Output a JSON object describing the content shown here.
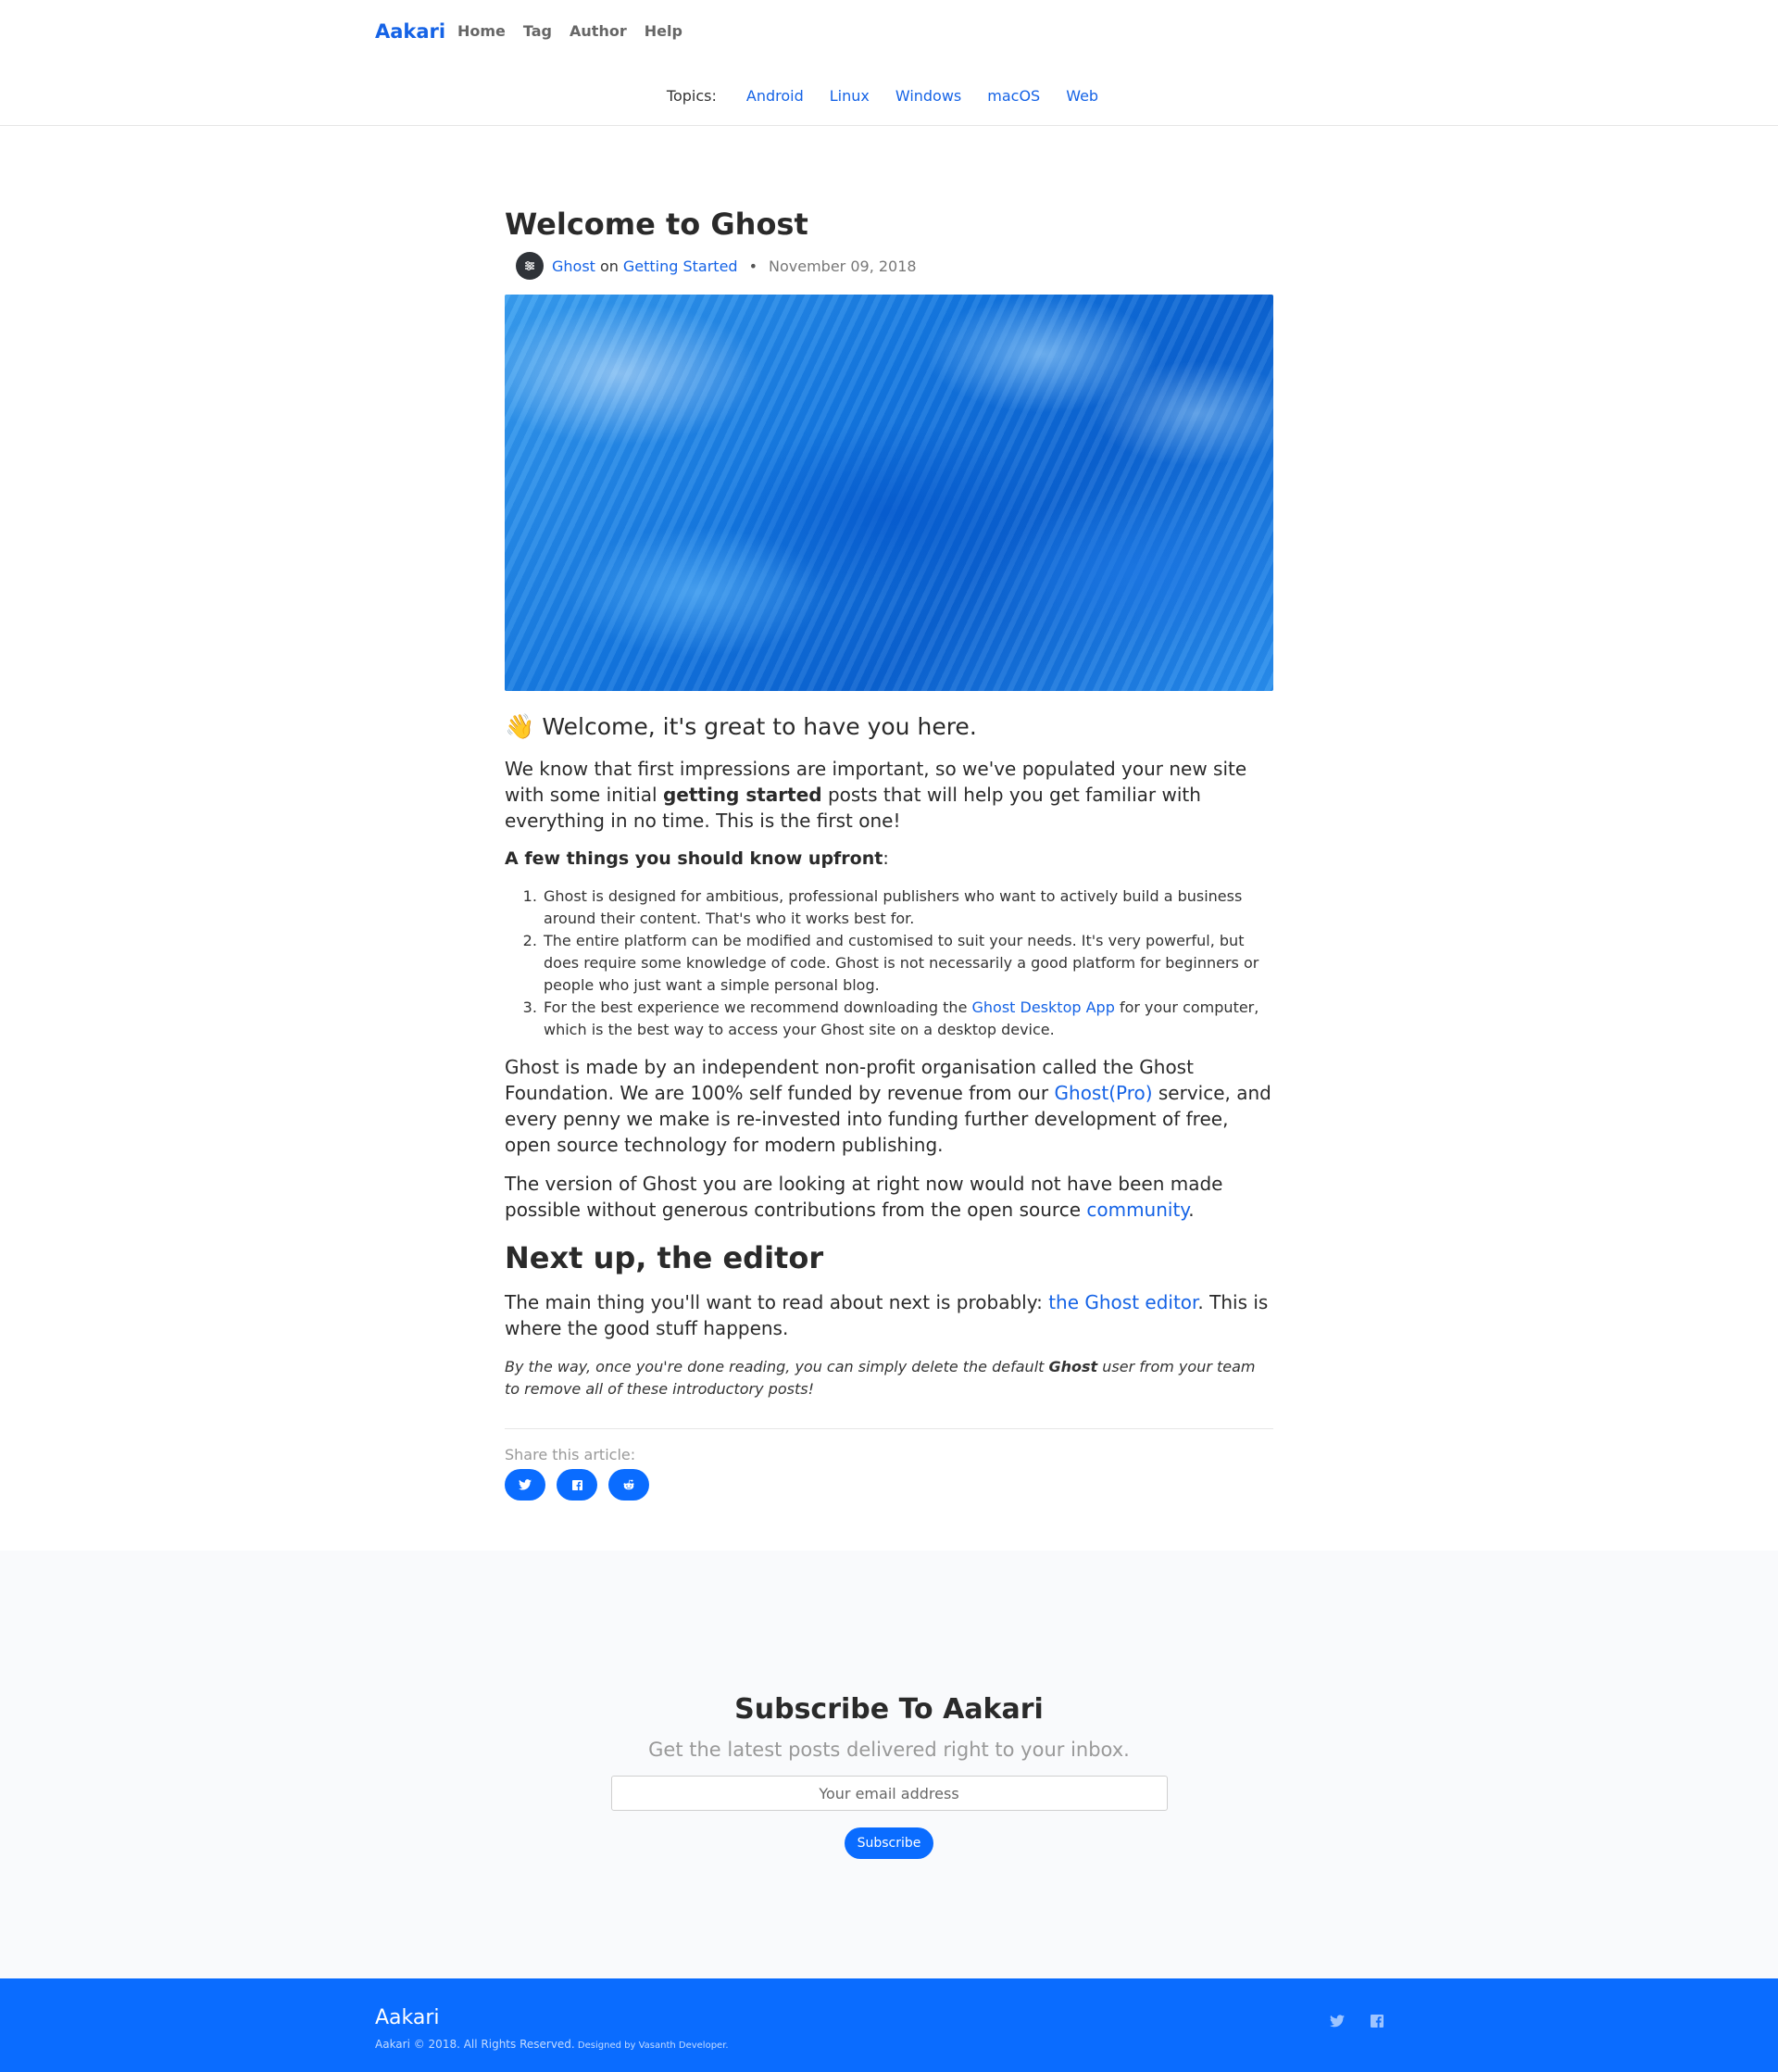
{
  "site": {
    "brand": "Aakari",
    "nav": [
      "Home",
      "Tag",
      "Author",
      "Help"
    ],
    "topics_label": "Topics:",
    "topics": [
      "Android",
      "Linux",
      "Windows",
      "macOS",
      "Web"
    ]
  },
  "post": {
    "title": "Welcome to Ghost",
    "author": "Ghost",
    "on": "on",
    "tag": "Getting Started",
    "date": "November 09, 2018",
    "lead": "Welcome, it's great to have you here.",
    "intro_1": "We know that first impressions are important, so we've populated your new site with some initial ",
    "intro_bold": "getting started",
    "intro_2": " posts that will help you get familiar with everything in no time. This is the first one!",
    "few_things": "A few things you should know upfront",
    "few_things_colon": ":",
    "steps": {
      "s1": "Ghost is designed for ambitious, professional publishers who want to actively build a business around their content. That's who it works best for.",
      "s2": "The entire platform can be modified and customised to suit your needs. It's very powerful, but does require some knowledge of code. Ghost is not necessarily a good platform for beginners or people who just want a simple personal blog.",
      "s3_a": "For the best experience we recommend downloading the ",
      "s3_link": "Ghost Desktop App",
      "s3_b": " for your computer, which is the best way to access your Ghost site on a desktop device."
    },
    "foundation_a": "Ghost is made by an independent non-profit organisation called the Ghost Foundation. We are 100% self funded by revenue from our ",
    "foundation_link": "Ghost(Pro)",
    "foundation_b": " service, and every penny we make is re-invested into funding further development of free, open source technology for modern publishing.",
    "version_a": "The version of Ghost you are looking at right now would not have been made possible without generous contributions from the open source ",
    "version_link": "community",
    "version_b": ".",
    "next_heading": "Next up, the editor",
    "next_a": "The main thing you'll want to read about next is probably: ",
    "next_link": "the Ghost editor",
    "next_b": ". This is where the good stuff happens.",
    "note_a": "By the way, once you're done reading, you can simply delete the default ",
    "note_bold": "Ghost",
    "note_b": " user from your team to remove all of these introductory posts!",
    "share_label": "Share this article:"
  },
  "subscribe": {
    "title": "Subscribe To Aakari",
    "subtitle": "Get the latest posts delivered right to your inbox.",
    "placeholder": "Your email address",
    "button": "Subscribe"
  },
  "footer": {
    "brand": "Aakari",
    "copyright": "Aakari © 2018. All Rights Reserved.",
    "designed": " Designed by Vasanth Developer."
  },
  "colors": {
    "accent": "#1563e6",
    "button": "#0a6cff",
    "footer_bg": "#0a6cff"
  },
  "icons": [
    "sliders-icon",
    "wave-hand-icon",
    "twitter-icon",
    "facebook-icon",
    "reddit-icon"
  ]
}
